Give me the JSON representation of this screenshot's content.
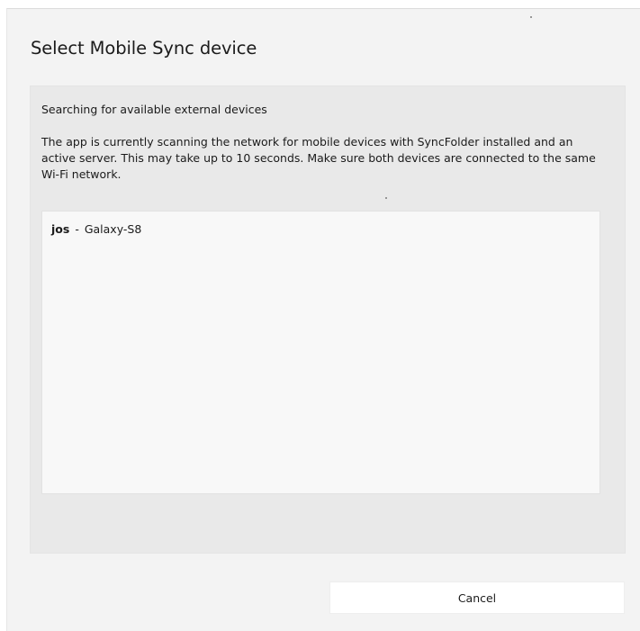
{
  "dialog": {
    "title": "Select Mobile Sync device",
    "cancel_label": "Cancel"
  },
  "search": {
    "heading": "Searching for available external devices",
    "description": "The app is currently scanning the network for mobile devices with SyncFolder installed and an active server. This may take up to 10 seconds. Make sure both devices are connected to the same Wi-Fi network."
  },
  "devices": [
    {
      "name": "jos",
      "separator": "-",
      "model": "Galaxy-S8"
    }
  ]
}
